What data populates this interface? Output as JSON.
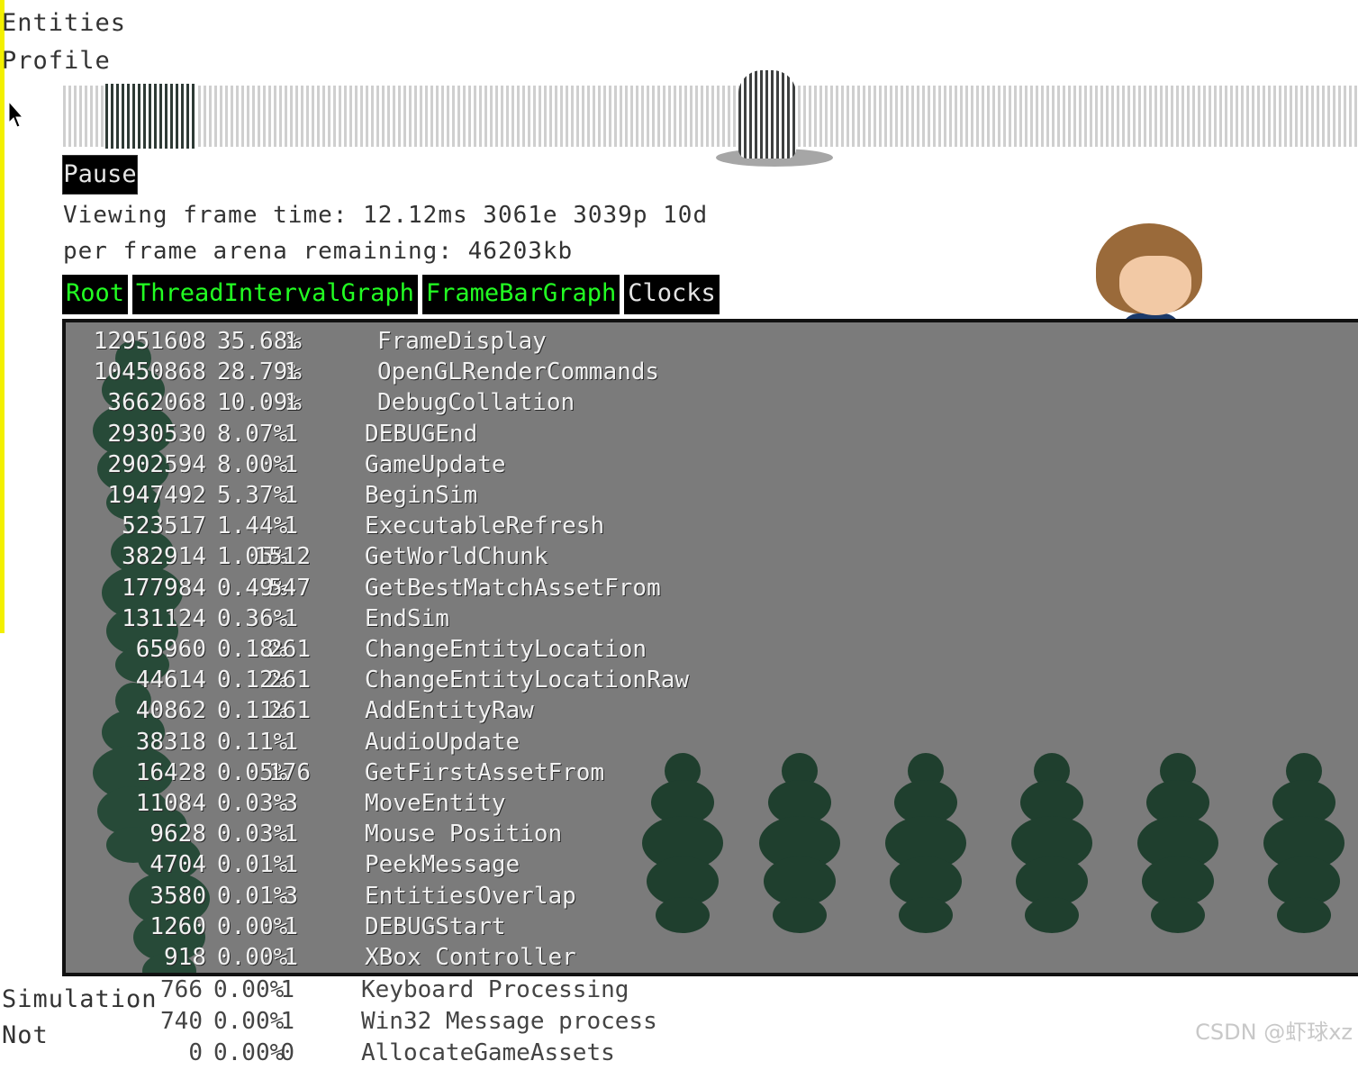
{
  "side_menu": {
    "entities": "Entities",
    "profile": "Profile",
    "simulation": "Simulation",
    "not": "Not"
  },
  "pause_label": "Pause",
  "frame_info": "Viewing frame time: 12.12ms 3061e 3039p 10d",
  "arena_info": "per frame arena remaining: 46203kb",
  "tabs": [
    {
      "label": "Root",
      "color": "#22ff22"
    },
    {
      "label": "ThreadIntervalGraph",
      "color": "#22ff22"
    },
    {
      "label": "FrameBarGraph",
      "color": "#22ff22"
    },
    {
      "label": "Clocks",
      "color": "#e4e4e4"
    }
  ],
  "profile_rows": [
    {
      "cycles": "12951608",
      "percent": "35.68%",
      "count": "1",
      "name": "FrameDisplay"
    },
    {
      "cycles": "10450868",
      "percent": "28.79%",
      "count": "1",
      "name": "OpenGLRenderCommands"
    },
    {
      "cycles": "3662068",
      "percent": "10.09%",
      "count": "1",
      "name": "DebugCollation"
    },
    {
      "cycles": "2930530",
      "percent": "8.07%",
      "count": "1",
      "name": "DEBUGEnd"
    },
    {
      "cycles": "2902594",
      "percent": "8.00%",
      "count": "1",
      "name": "GameUpdate"
    },
    {
      "cycles": "1947492",
      "percent": "5.37%",
      "count": "1",
      "name": "BeginSim"
    },
    {
      "cycles": "523517",
      "percent": "1.44%",
      "count": "1",
      "name": "ExecutableRefresh"
    },
    {
      "cycles": "382914",
      "percent": "1.05%",
      "count": "1512",
      "name": "GetWorldChunk"
    },
    {
      "cycles": "177984",
      "percent": "0.49%",
      "count": "547",
      "name": "GetBestMatchAssetFrom"
    },
    {
      "cycles": "131124",
      "percent": "0.36%",
      "count": "1",
      "name": "EndSim"
    },
    {
      "cycles": "65960",
      "percent": "0.18%",
      "count": "261",
      "name": "ChangeEntityLocation"
    },
    {
      "cycles": "44614",
      "percent": "0.12%",
      "count": "261",
      "name": "ChangeEntityLocationRaw"
    },
    {
      "cycles": "40862",
      "percent": "0.11%",
      "count": "261",
      "name": "AddEntityRaw"
    },
    {
      "cycles": "38318",
      "percent": "0.11%",
      "count": "1",
      "name": "AudioUpdate"
    },
    {
      "cycles": "16428",
      "percent": "0.05%",
      "count": "176",
      "name": "GetFirstAssetFrom"
    },
    {
      "cycles": "11084",
      "percent": "0.03%",
      "count": "3",
      "name": "MoveEntity"
    },
    {
      "cycles": "9628",
      "percent": "0.03%",
      "count": "1",
      "name": "Mouse Position"
    },
    {
      "cycles": "4704",
      "percent": "0.01%",
      "count": "1",
      "name": "PeekMessage"
    },
    {
      "cycles": "3580",
      "percent": "0.01%",
      "count": "3",
      "name": "EntitiesOverlap"
    },
    {
      "cycles": "1260",
      "percent": "0.00%",
      "count": "1",
      "name": "DEBUGStart"
    },
    {
      "cycles": "918",
      "percent": "0.00%",
      "count": "1",
      "name": "XBox Controller"
    }
  ],
  "overflow_rows": [
    {
      "cycles": "766",
      "percent": "0.00%",
      "count": "1",
      "name": "Keyboard Processing"
    },
    {
      "cycles": "740",
      "percent": "0.00%",
      "count": "1",
      "name": "Win32 Message process"
    },
    {
      "cycles": "0",
      "percent": "0.00%",
      "count": "0",
      "name": "AllocateGameAssets"
    }
  ],
  "watermark": "CSDN @虾球xz"
}
